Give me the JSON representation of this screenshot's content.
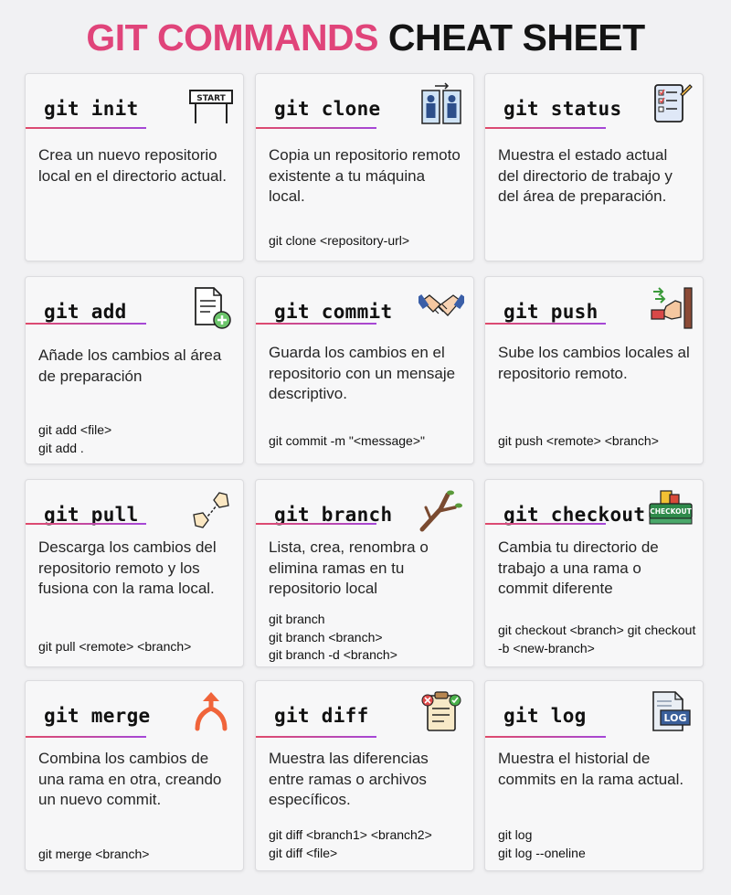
{
  "title": {
    "part1": "GIT COMMANDS",
    "part2": "CHEAT SHEET"
  },
  "colors": {
    "title_pink": "#e0447a",
    "underline_start": "#e04a6a",
    "underline_end": "#a547d8"
  },
  "cards": [
    {
      "name": "git-init",
      "command": "git init",
      "icon": "start-sign-icon",
      "description": "Crea un nuevo repositorio local en el directorio actual.",
      "usage": ""
    },
    {
      "name": "git-clone",
      "command": "git clone",
      "icon": "clone-people-icon",
      "description": "Copia un repositorio remoto existente a tu máquina local.",
      "usage": "git clone <repository-url>"
    },
    {
      "name": "git-status",
      "command": "git status",
      "icon": "checklist-icon",
      "description": "Muestra el estado actual del directorio de trabajo y del área de preparación.",
      "usage": ""
    },
    {
      "name": "git-add",
      "command": "git add",
      "icon": "add-file-icon",
      "description": "Añade los cambios al área de preparación",
      "usage": "git add <file>\ngit add ."
    },
    {
      "name": "git-commit",
      "command": "git commit",
      "icon": "handshake-icon",
      "description": "Guarda los cambios en el repositorio con un mensaje descriptivo.",
      "usage": "git commit -m \"<message>\""
    },
    {
      "name": "git-push",
      "command": "git push",
      "icon": "push-hand-icon",
      "description": "Sube los cambios locales al repositorio remoto.",
      "usage": "git push <remote> <branch>"
    },
    {
      "name": "git-pull",
      "command": "git pull",
      "icon": "pull-hands-icon",
      "description": "Descarga los cambios del repositorio remoto y los fusiona con la rama local.",
      "usage": "git pull <remote> <branch>"
    },
    {
      "name": "git-branch",
      "command": "git branch",
      "icon": "tree-branch-icon",
      "description": "Lista, crea, renombra o elimina ramas en tu repositorio local",
      "usage": "git branch\ngit branch <branch>\ngit branch -d <branch>"
    },
    {
      "name": "git-checkout",
      "command": "git checkout",
      "icon": "checkout-sign-icon",
      "description": "Cambia tu directorio de trabajo a una rama o commit diferente",
      "usage": "git checkout <branch> git checkout -b <new-branch>"
    },
    {
      "name": "git-merge",
      "command": "git merge",
      "icon": "merge-arrow-icon",
      "description": "Combina los cambios de una rama en otra, creando un nuevo commit.",
      "usage": "git merge <branch>"
    },
    {
      "name": "git-diff",
      "command": "git diff",
      "icon": "diff-clipboard-icon",
      "description": "Muestra las diferencias entre ramas o archivos específicos.",
      "usage": "git diff <branch1> <branch2>\ngit diff <file>"
    },
    {
      "name": "git-log",
      "command": "git log",
      "icon": "log-file-icon",
      "description": "Muestra el historial de commits en la rama actual.",
      "usage": "git log\ngit log --oneline"
    }
  ]
}
